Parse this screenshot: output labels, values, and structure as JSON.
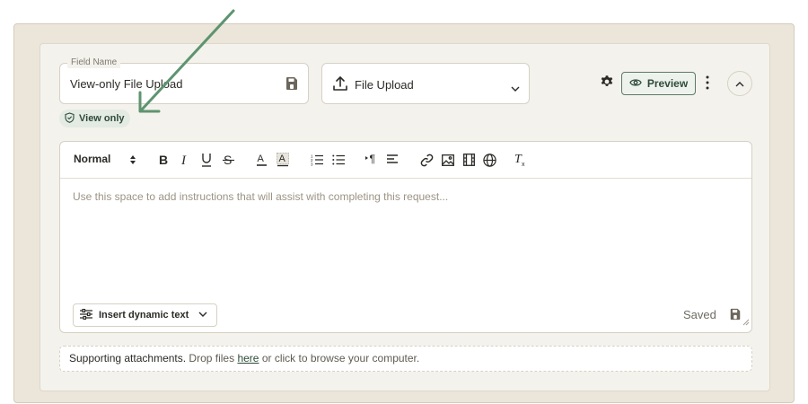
{
  "field_name": {
    "legend": "Field Name",
    "value": "View-only File Upload"
  },
  "field_type": {
    "selected": "File Upload"
  },
  "header_actions": {
    "preview_label": "Preview"
  },
  "badge": {
    "label": "View only"
  },
  "editor": {
    "toolbar": {
      "style_select": "Normal",
      "buttons": [
        "bold",
        "italic",
        "underline",
        "strikethrough",
        "text-color",
        "highlight",
        "ordered-list",
        "bullet-list",
        "rtl",
        "align",
        "link",
        "image",
        "video",
        "formula",
        "clear-formatting"
      ]
    },
    "placeholder": "Use this space to add instructions that will assist with completing this request...",
    "dynamic_text_label": "Insert dynamic text",
    "saved_label": "Saved"
  },
  "attachments": {
    "lead": "Supporting attachments.",
    "mid": "Drop files",
    "link": "here",
    "tail": "or click to browse your computer."
  },
  "colors": {
    "accent": "#2e4a39",
    "annotation_arrow": "#5e9470",
    "outer_bg": "#ece5da",
    "card_bg": "#f4f2ec"
  }
}
